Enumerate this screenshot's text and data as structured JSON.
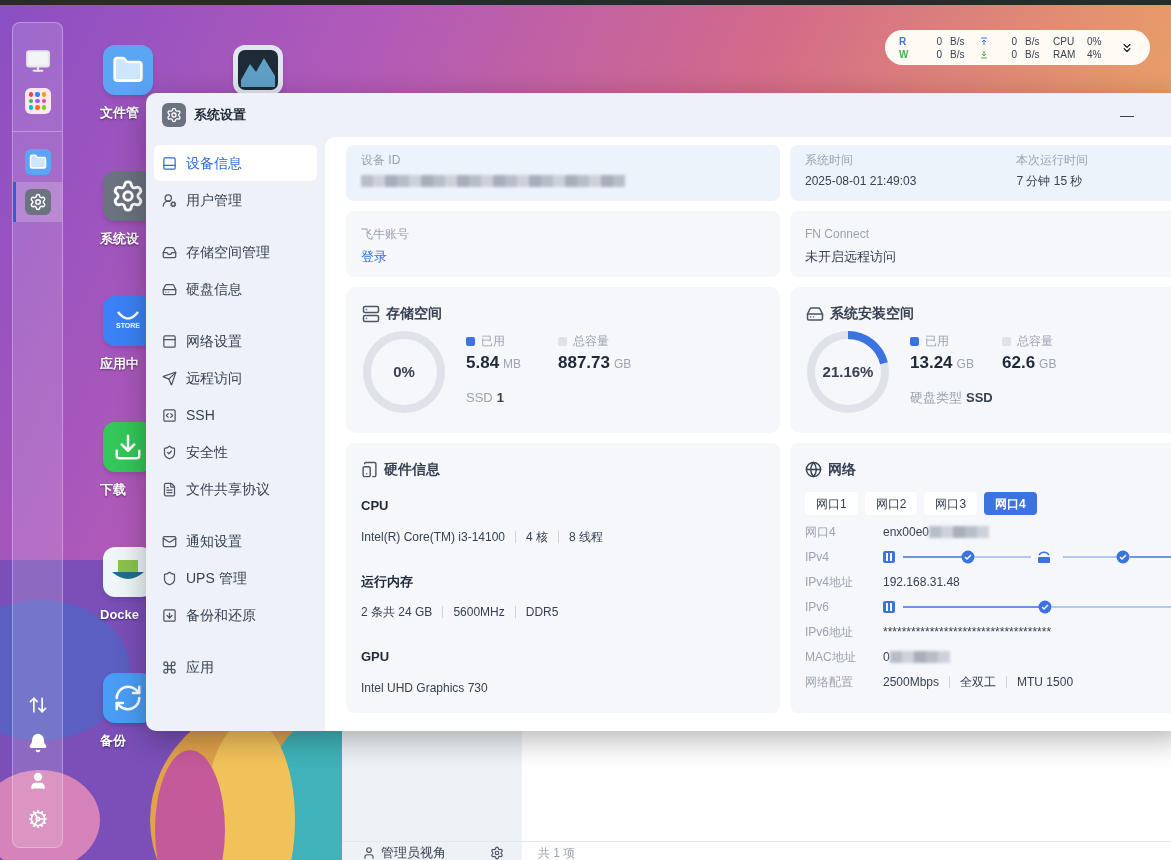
{
  "dock": {
    "items": [
      {
        "selected": false
      },
      {
        "selected": false
      },
      {
        "selected": false
      },
      {
        "selected": true
      }
    ]
  },
  "desktop_icons": [
    {
      "label": "文件管"
    },
    {
      "label": "系统设"
    },
    {
      "label": "应用中"
    },
    {
      "label": "下载"
    },
    {
      "label": "Docke"
    },
    {
      "label": "备份"
    }
  ],
  "store_icon_text": "STORE",
  "status_widget": {
    "rows": [
      {
        "label": "R",
        "disk_value": "0",
        "disk_unit": "B/s",
        "net_value": "0",
        "net_unit": "B/s",
        "metric": "CPU",
        "metric_value": "0%"
      },
      {
        "label": "W",
        "disk_value": "0",
        "disk_unit": "B/s",
        "net_value": "0",
        "net_unit": "B/s",
        "metric": "RAM",
        "metric_value": "4%"
      }
    ]
  },
  "window": {
    "title": "系统设置",
    "minimize": "—"
  },
  "sidebar": {
    "groups": [
      [
        {
          "label": "设备信息",
          "selected": true
        },
        {
          "label": "用户管理",
          "selected": false
        }
      ],
      [
        {
          "label": "存储空间管理",
          "selected": false
        },
        {
          "label": "硬盘信息",
          "selected": false
        }
      ],
      [
        {
          "label": "网络设置",
          "selected": false
        },
        {
          "label": "远程访问",
          "selected": false
        },
        {
          "label": "SSH",
          "selected": false
        },
        {
          "label": "安全性",
          "selected": false
        },
        {
          "label": "文件共享协议",
          "selected": false
        }
      ],
      [
        {
          "label": "通知设置",
          "selected": false
        },
        {
          "label": "UPS 管理",
          "selected": false
        },
        {
          "label": "备份和还原",
          "selected": false
        }
      ],
      [
        {
          "label": "应用",
          "selected": false
        }
      ]
    ]
  },
  "device": {
    "id_label": "设备 ID",
    "time_label": "系统时间",
    "time_value": "2025-08-01 21:49:03",
    "uptime_label": "本次运行时间",
    "uptime_value": "7 分钟 15 秒"
  },
  "account": {
    "label": "飞牛账号",
    "link": "登录"
  },
  "fn_connect": {
    "label": "FN Connect",
    "value": "未开启远程访问"
  },
  "storage_cards": [
    {
      "title": "存储空间",
      "level": 0,
      "percent": "0%",
      "used_label": "已用",
      "used_value": "5.84",
      "used_unit": "MB",
      "total_label": "总容量",
      "total_value": "887.73",
      "total_unit": "GB",
      "footer_label": "SSD",
      "footer_value": "1"
    },
    {
      "title": "系统安装空间",
      "level": 0.2116,
      "percent": "21.16%",
      "used_label": "已用",
      "used_value": "13.24",
      "used_unit": "GB",
      "total_label": "总容量",
      "total_value": "62.6",
      "total_unit": "GB",
      "footer_label": "硬盘类型",
      "footer_value": "SSD"
    }
  ],
  "hardware": {
    "title": "硬件信息",
    "sections": [
      {
        "title": "CPU",
        "values": [
          "Intel(R) Core(TM) i3-14100",
          "4 核",
          "8 线程"
        ]
      },
      {
        "title": "运行内存",
        "values": [
          "2 条共 24 GB",
          "5600MHz",
          "DDR5"
        ]
      },
      {
        "title": "GPU",
        "values": [
          "Intel UHD Graphics 730"
        ]
      }
    ]
  },
  "network": {
    "title": "网络",
    "tabs": [
      {
        "label": "网口1",
        "selected": false
      },
      {
        "label": "网口2",
        "selected": false
      },
      {
        "label": "网口3",
        "selected": false
      },
      {
        "label": "网口4",
        "selected": true
      }
    ],
    "rows": [
      {
        "kind": "redacted",
        "label": "网口4",
        "value": "enx00e0"
      },
      {
        "kind": "link-router",
        "label": "IPv4"
      },
      {
        "kind": "text",
        "label": "IPv4地址",
        "value": "192.168.31.48"
      },
      {
        "kind": "link",
        "label": "IPv6"
      },
      {
        "kind": "text",
        "label": "IPv6地址",
        "value": "************************************"
      },
      {
        "kind": "redacted",
        "label": "MAC地址",
        "value": "0"
      },
      {
        "kind": "list",
        "label": "网络配置",
        "values": [
          "2500Mbps",
          "全双工",
          "MTU 1500"
        ]
      }
    ]
  },
  "background_window": {
    "sidebar_item": "管理员视角",
    "footer": "共 1 项"
  }
}
